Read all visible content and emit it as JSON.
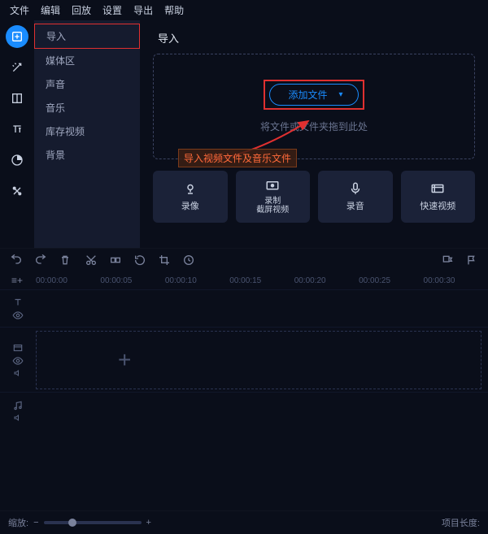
{
  "menu": {
    "file": "文件",
    "edit": "编辑",
    "playback": "回放",
    "settings": "设置",
    "export": "导出",
    "help": "帮助"
  },
  "sidebar": {
    "items": [
      "导入",
      "媒体区",
      "声音",
      "音乐",
      "库存视频",
      "背景"
    ]
  },
  "main": {
    "title": "导入",
    "add_files": "添加文件",
    "drop_hint": "将文件或文件夹拖到此处",
    "annotation": "导入视频文件及音乐文件"
  },
  "cards": {
    "c0": {
      "label": "录像"
    },
    "c1": {
      "label": "录制",
      "sub": "截屏视频"
    },
    "c2": {
      "label": "录音"
    },
    "c3": {
      "label": "快速视频"
    }
  },
  "ruler": [
    "00:00:00",
    "00:00:05",
    "00:00:10",
    "00:00:15",
    "00:00:20",
    "00:00:25",
    "00:00:30"
  ],
  "footer": {
    "zoom_label": "缩放:",
    "duration_label": "项目长度:"
  }
}
